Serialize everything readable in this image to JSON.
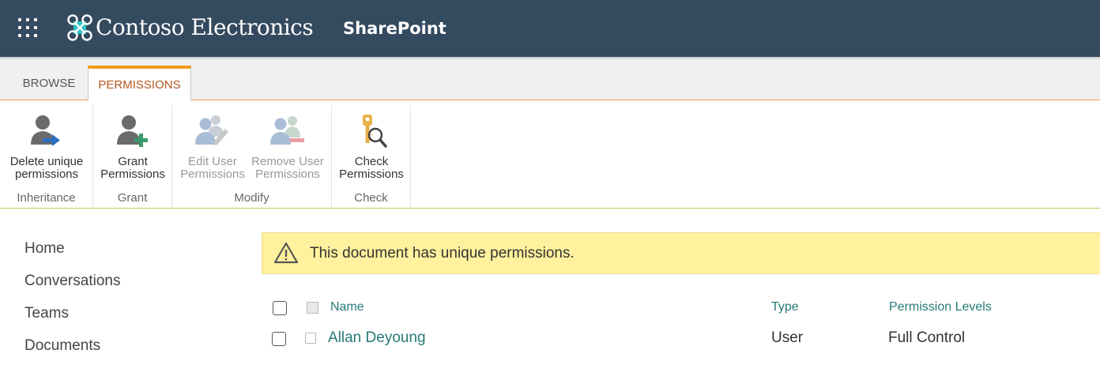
{
  "suite_bar": {
    "brand": "Contoso Electronics",
    "app_name": "SharePoint"
  },
  "ribbon": {
    "tabs": [
      {
        "label": "BROWSE",
        "selected": false
      },
      {
        "label": "PERMISSIONS",
        "selected": true
      }
    ],
    "groups": [
      {
        "label": "Inheritance",
        "buttons": [
          {
            "line1": "Delete unique",
            "line2": "permissions",
            "icon": "user-arrow-icon",
            "enabled": true
          }
        ]
      },
      {
        "label": "Grant",
        "buttons": [
          {
            "line1": "Grant",
            "line2": "Permissions",
            "icon": "user-add-icon",
            "enabled": true
          }
        ]
      },
      {
        "label": "Modify",
        "buttons": [
          {
            "line1": "Edit User",
            "line2": "Permissions",
            "icon": "users-edit-icon",
            "enabled": false
          },
          {
            "line1": "Remove User",
            "line2": "Permissions",
            "icon": "users-remove-icon",
            "enabled": false
          }
        ]
      },
      {
        "label": "Check",
        "buttons": [
          {
            "line1": "Check",
            "line2": "Permissions",
            "icon": "key-search-icon",
            "enabled": true
          }
        ]
      }
    ]
  },
  "nav": {
    "items": [
      "Home",
      "Conversations",
      "Teams",
      "Documents"
    ]
  },
  "message": {
    "text": "This document has unique permissions.",
    "icon": "warning-icon"
  },
  "list": {
    "columns": {
      "name": "Name",
      "type": "Type",
      "permission_levels": "Permission Levels"
    },
    "rows": [
      {
        "name": "Allan Deyoung",
        "type": "User",
        "permission_levels": "Full Control"
      }
    ]
  },
  "colors": {
    "suite_bar": "#344a5f",
    "accent_orange": "#f29b1d",
    "link_teal": "#267a77",
    "message_bg": "#fff19d"
  }
}
